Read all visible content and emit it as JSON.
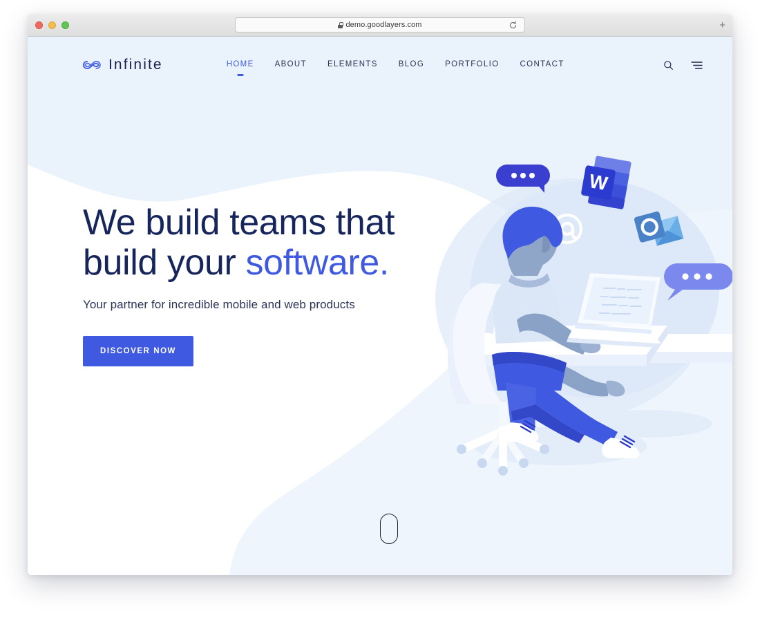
{
  "browser": {
    "url": "demo.goodlayers.com",
    "lock_icon": "lock-icon",
    "reload_icon": "reload-icon",
    "new_tab_label": "+",
    "traffic_lights": [
      "close-red",
      "minimize-yellow",
      "maximize-green"
    ]
  },
  "site": {
    "logo": {
      "text": "Infinite",
      "mark_icon": "infinity-logo-icon"
    },
    "nav": [
      {
        "label": "HOME",
        "active": true
      },
      {
        "label": "ABOUT",
        "active": false
      },
      {
        "label": "ELEMENTS",
        "active": false
      },
      {
        "label": "BLOG",
        "active": false
      },
      {
        "label": "PORTFOLIO",
        "active": false
      },
      {
        "label": "CONTACT",
        "active": false
      }
    ],
    "tools": {
      "search_icon": "search-icon",
      "menu_icon": "hamburger-menu-icon"
    }
  },
  "hero": {
    "title_line1": "We build teams that",
    "title_line2_lead": "build your ",
    "title_line2_accent": "software.",
    "subtitle": "Your partner for incredible mobile and web products",
    "cta_label": "DISCOVER NOW",
    "scroll_hint_icon": "mouse-scroll-icon"
  },
  "illustration": {
    "name": "person-working-at-desk-illustration",
    "elements": [
      "chat-bubble-dark",
      "chat-bubble-light",
      "microsoft-word-icon",
      "microsoft-outlook-icon",
      "at-symbol-icon",
      "laptop",
      "office-chair",
      "desk"
    ],
    "word_icon_letter": "W",
    "outlook_icon_letter": "O",
    "at_symbol": "@"
  },
  "colors": {
    "accent_blue": "#3f5ae0",
    "deep_navy": "#16255c",
    "light_blue_wash": "#eaf2fc",
    "pale_blue": "#dce8f8",
    "page_white": "#ffffff",
    "chat_dark": "#3b3fd0",
    "chat_light": "#7b89ef"
  }
}
